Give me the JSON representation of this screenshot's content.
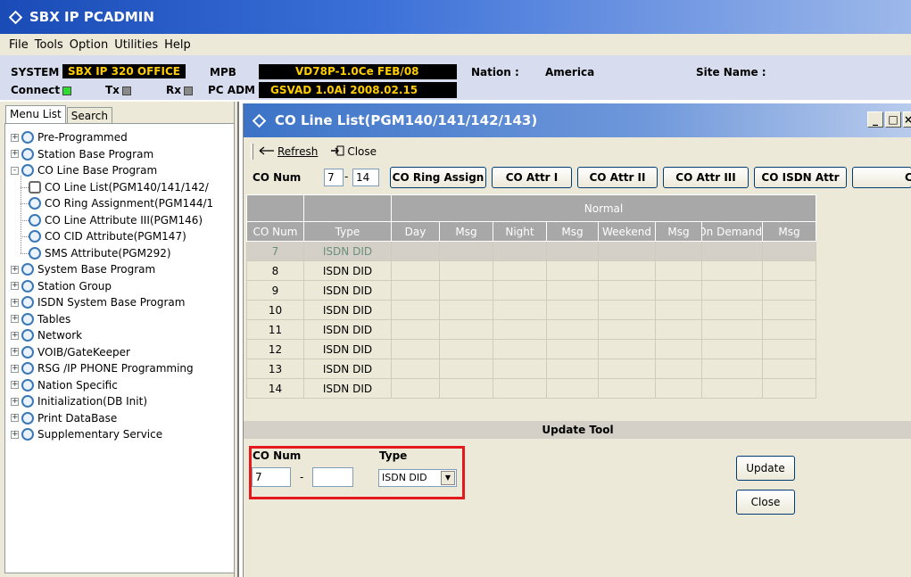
{
  "app": {
    "title": "SBX IP PCADMIN"
  },
  "menu": [
    "File",
    "Tools",
    "Option",
    "Utilities",
    "Help"
  ],
  "info": {
    "system_label": "SYSTEM",
    "system_value": "SBX IP 320 OFFICE",
    "mpb_label": "MPB",
    "mpb_value": "VD78P-1.0Ce FEB/08",
    "nation_label": "Nation :",
    "nation_value": "America",
    "site_label": "Site Name :",
    "connect_label": "Connect",
    "tx_label": "Tx",
    "rx_label": "Rx",
    "pcadm_label": "PC ADM",
    "pcadm_value": "GSVAD 1.0Ai 2008.02.15"
  },
  "left_tabs": [
    "Menu List",
    "Search"
  ],
  "tree": [
    {
      "label": "Pre-Programmed",
      "level": 0,
      "expander": "+"
    },
    {
      "label": "Station Base Program",
      "level": 0,
      "expander": "+"
    },
    {
      "label": "CO Line Base Program",
      "level": 0,
      "expander": "-"
    },
    {
      "label": "CO Line List(PGM140/141/142/",
      "level": 1,
      "expander": ""
    },
    {
      "label": "CO Ring Assignment(PGM144/1",
      "level": 1,
      "expander": ""
    },
    {
      "label": "CO Line Attribute III(PGM146)",
      "level": 1,
      "expander": ""
    },
    {
      "label": "CO CID Attribute(PGM147)",
      "level": 1,
      "expander": ""
    },
    {
      "label": "SMS Attribute(PGM292)",
      "level": 1,
      "expander": ""
    },
    {
      "label": "System Base Program",
      "level": 0,
      "expander": "+"
    },
    {
      "label": "Station Group",
      "level": 0,
      "expander": "+"
    },
    {
      "label": "ISDN System Base Program",
      "level": 0,
      "expander": "+"
    },
    {
      "label": "Tables",
      "level": 0,
      "expander": "+"
    },
    {
      "label": "Network",
      "level": 0,
      "expander": "+"
    },
    {
      "label": "VOIB/GateKeeper",
      "level": 0,
      "expander": "+"
    },
    {
      "label": "RSG /IP PHONE Programming",
      "level": 0,
      "expander": "+"
    },
    {
      "label": "Nation Specific",
      "level": 0,
      "expander": "+"
    },
    {
      "label": "Initialization(DB Init)",
      "level": 0,
      "expander": "+"
    },
    {
      "label": "Print DataBase",
      "level": 0,
      "expander": "+"
    },
    {
      "label": "Supplementary Service",
      "level": 0,
      "expander": "+"
    }
  ],
  "child": {
    "title": "CO Line List(PGM140/141/142/143)",
    "refresh": "Refresh",
    "close": "Close",
    "filter_label": "CO Num",
    "from": "7",
    "to": "14",
    "buttons": [
      "CO Ring Assign",
      "CO Attr I",
      "CO Attr II",
      "CO Attr III",
      "CO ISDN Attr",
      "C"
    ]
  },
  "grid": {
    "group_header": "Normal",
    "columns": [
      "CO Num",
      "Type",
      "Day",
      "Msg",
      "Night",
      "Msg",
      "Weekend",
      "Msg",
      "On Demand",
      "Msg"
    ],
    "rows": [
      [
        "7",
        "ISDN DID"
      ],
      [
        "8",
        "ISDN DID"
      ],
      [
        "9",
        "ISDN DID"
      ],
      [
        "10",
        "ISDN DID"
      ],
      [
        "11",
        "ISDN DID"
      ],
      [
        "12",
        "ISDN DID"
      ],
      [
        "13",
        "ISDN DID"
      ],
      [
        "14",
        "ISDN DID"
      ]
    ]
  },
  "update": {
    "title": "Update Tool",
    "co_label": "CO Num",
    "from": "7",
    "to": "",
    "type_label": "Type",
    "type_value": "ISDN DID",
    "update_btn": "Update",
    "close_btn": "Close"
  }
}
